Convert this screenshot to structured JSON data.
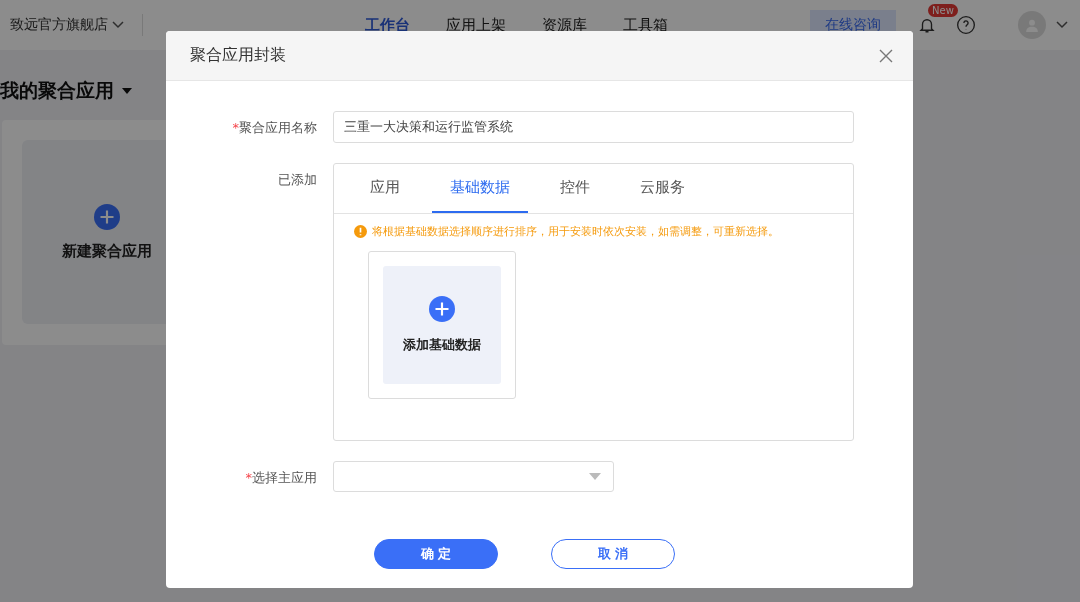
{
  "header": {
    "store": "致远官方旗舰店",
    "nav": [
      {
        "label": "工作台",
        "selected": true
      },
      {
        "label": "应用上架",
        "selected": false
      },
      {
        "label": "资源库",
        "selected": false
      },
      {
        "label": "工具箱",
        "selected": false
      }
    ],
    "consult": "在线咨询",
    "badge": "New"
  },
  "page": {
    "title": "我的聚合应用",
    "new_card": "新建聚合应用"
  },
  "dialog": {
    "title": "聚合应用封装",
    "name_field": {
      "label": "聚合应用名称",
      "required_mark": "*",
      "value": "三重一大决策和运行监管系统"
    },
    "added": {
      "label": "已添加",
      "tabs": [
        {
          "label": "应用",
          "selected": false
        },
        {
          "label": "基础数据",
          "selected": true
        },
        {
          "label": "控件",
          "selected": false
        },
        {
          "label": "云服务",
          "selected": false
        }
      ],
      "warning": "将根据基础数据选择顺序进行排序，用于安装时依次安装，如需调整，可重新选择。",
      "add_tile": "添加基础数据"
    },
    "main_app": {
      "label": "选择主应用",
      "required_mark": "*"
    },
    "buttons": [
      {
        "label": "确 定",
        "kind": "primary"
      },
      {
        "label": "取 消",
        "kind": "secondary"
      }
    ]
  }
}
